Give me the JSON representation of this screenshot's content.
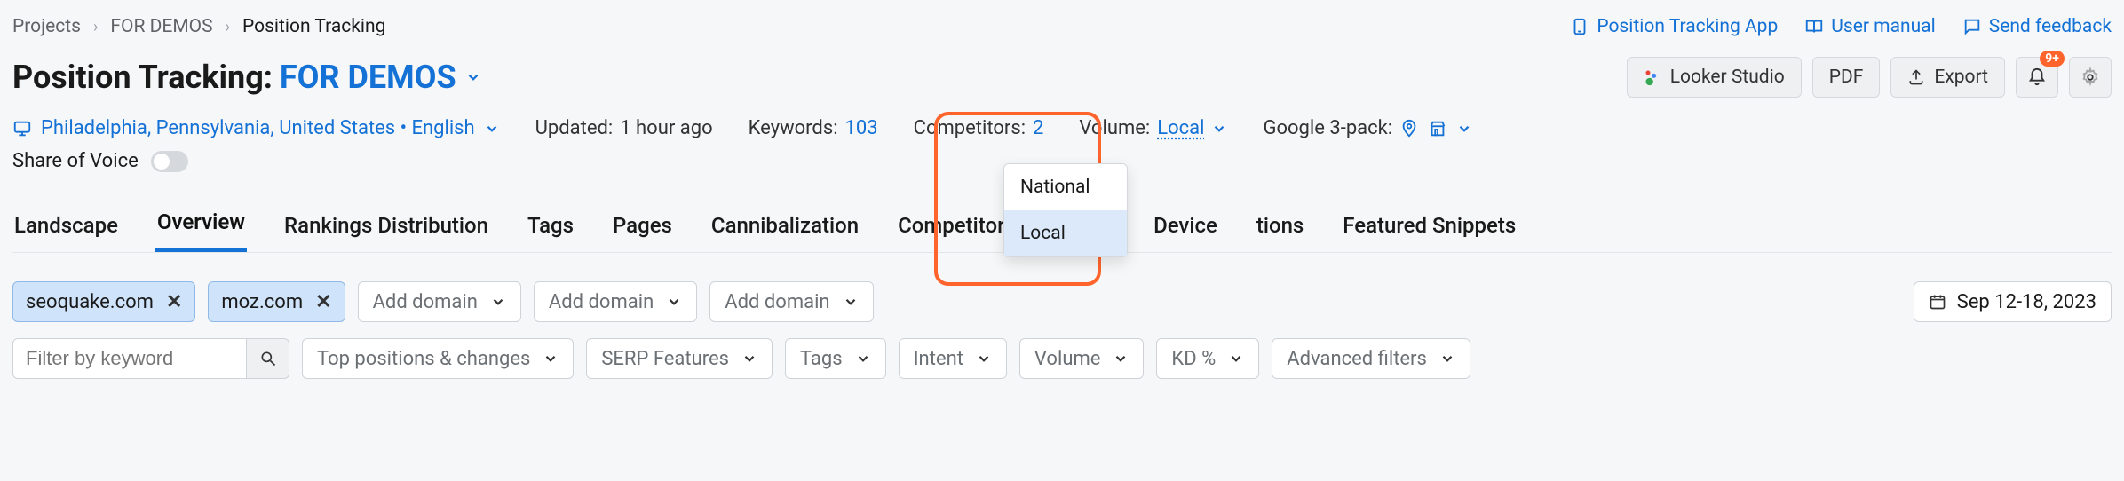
{
  "breadcrumbs": {
    "root": "Projects",
    "project": "FOR DEMOS",
    "page": "Position Tracking"
  },
  "top_links": {
    "app": "Position Tracking App",
    "manual": "User manual",
    "feedback": "Send feedback"
  },
  "title": {
    "prefix": "Position Tracking:",
    "project": "FOR DEMOS"
  },
  "title_actions": {
    "looker": "Looker Studio",
    "pdf": "PDF",
    "export": "Export",
    "notif_count": "9+"
  },
  "meta": {
    "location": "Philadelphia, Pennsylvania, United States • English",
    "updated_label": "Updated:",
    "updated_value": "1 hour ago",
    "keywords_label": "Keywords:",
    "keywords_value": "103",
    "competitors_label": "Competitors:",
    "competitors_value": "2",
    "volume_label": "Volume:",
    "volume_value": "Local",
    "gpack_label": "Google 3-pack:"
  },
  "volume_options": {
    "o1": "National",
    "o2": "Local"
  },
  "sov_label": "Share of Voice",
  "tabs": {
    "t1": "Landscape",
    "t2": "Overview",
    "t3": "Rankings Distribution",
    "t4": "Tags",
    "t5": "Pages",
    "t6": "Cannibalization",
    "t7": "Competitors Discovery",
    "t8": "Device",
    "t9": "tions",
    "t10": "Featured Snippets"
  },
  "chips": {
    "c1": "seoquake.com",
    "c2": "moz.com"
  },
  "add_domain_label": "Add domain",
  "date_range": "Sep 12-18, 2023",
  "filters": {
    "placeholder": "Filter by keyword",
    "f1": "Top positions & changes",
    "f2": "SERP Features",
    "f3": "Tags",
    "f4": "Intent",
    "f5": "Volume",
    "f6": "KD %",
    "f7": "Advanced filters"
  }
}
